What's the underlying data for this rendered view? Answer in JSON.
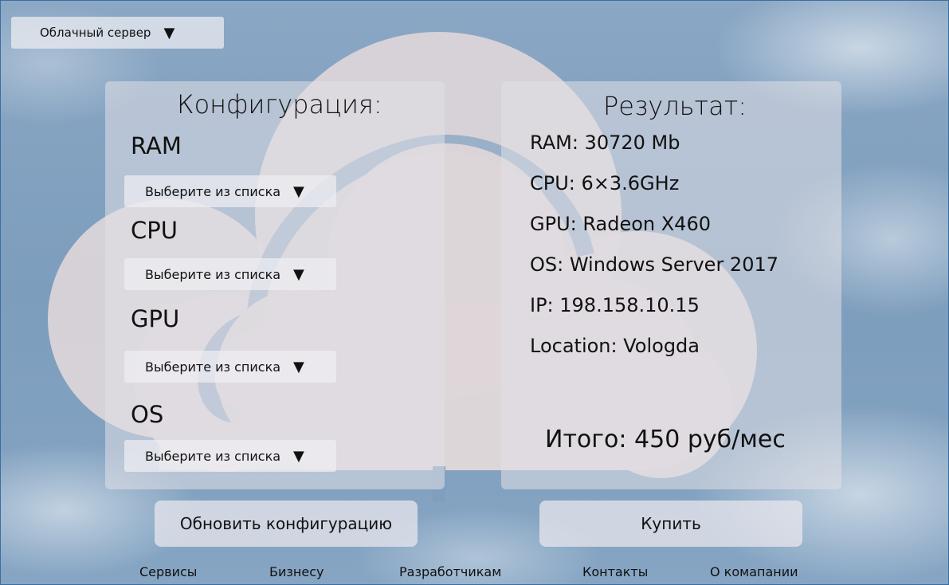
{
  "header": {
    "server_type_select": "Облачный сервер"
  },
  "config": {
    "title": "Конфигурация:",
    "fields": [
      {
        "label": "RAM",
        "placeholder": "Выберите из списка"
      },
      {
        "label": "CPU",
        "placeholder": "Выберите из списка"
      },
      {
        "label": "GPU",
        "placeholder": "Выберите из списка"
      },
      {
        "label": "OS",
        "placeholder": "Выберите из списка"
      }
    ]
  },
  "result": {
    "title": "Результат:",
    "lines": [
      "RAM: 30720 Mb",
      "CPU: 6×3.6GHz",
      "GPU: Radeon X460",
      "OS: Windows Server 2017",
      "IP: 198.158.10.15",
      "Location: Vologda"
    ],
    "total": "Итого: 450 руб/мес"
  },
  "actions": {
    "update_label": "Обновить конфигурацию",
    "buy_label": "Купить"
  },
  "footer": {
    "links": [
      "Сервисы",
      "Бизнесу",
      "Разработчикам",
      "Контакты",
      "О комапании"
    ]
  },
  "icons": {
    "dropdown": "caret-down-icon",
    "background_logo": "cloud-icon"
  },
  "colors": {
    "background": "#7d9dbd",
    "panel": "#e1e0e5",
    "cloud": "#ddd6d9",
    "border": "#3b6ea0"
  }
}
